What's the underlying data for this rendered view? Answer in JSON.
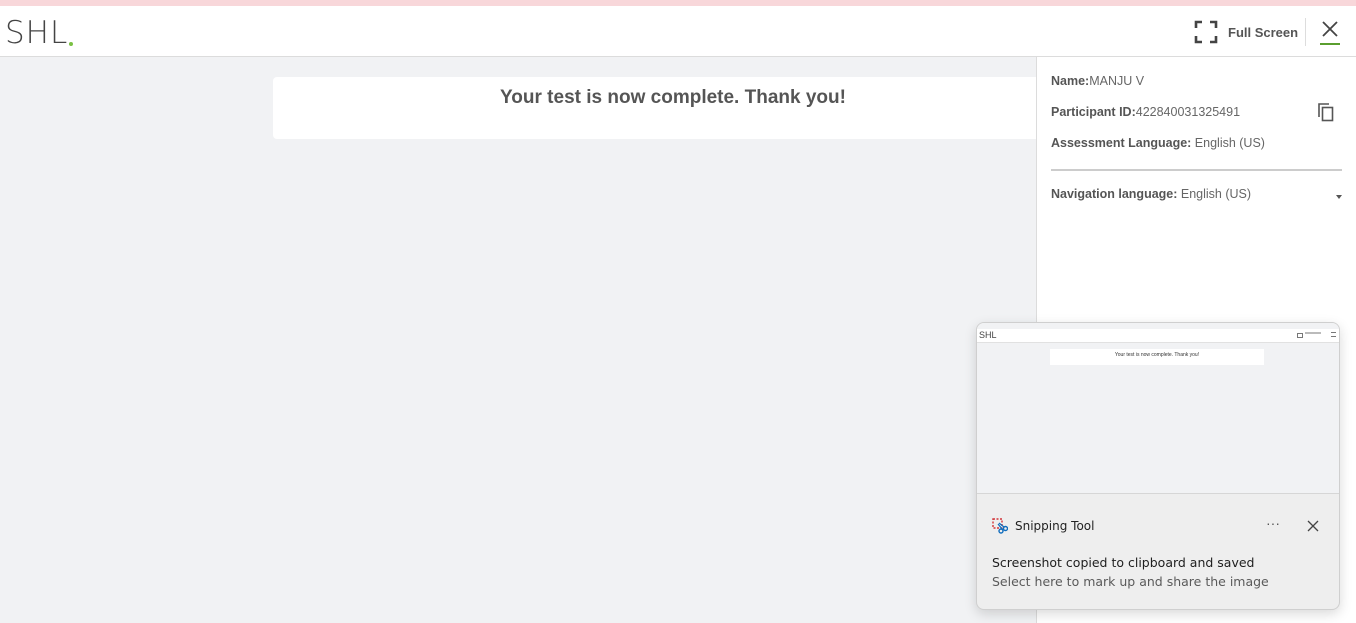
{
  "header": {
    "logo": "SHL",
    "fullscreen_label": "Full Screen"
  },
  "main": {
    "completion_message": "Your test is now complete. Thank you!"
  },
  "panel": {
    "name_label": "Name:",
    "name_value": "MANJU V",
    "participant_label": "Participant ID:",
    "participant_value": "422840031325491",
    "assessment_lang_label": "Assessment Language:",
    "assessment_lang_value": " English (US)",
    "nav_lang_label": "Navigation language:",
    "nav_lang_value": " English (US)"
  },
  "snip_notification": {
    "app_name": "Snipping Tool",
    "title": "Screenshot copied to clipboard and saved",
    "subtitle": "Select here to mark up and share the image",
    "more_label": "···",
    "thumbnail": {
      "logo": "SHL",
      "message": "Your test is now complete. Thank you!"
    }
  },
  "colors": {
    "accent_green": "#7ac143",
    "top_strip": "#f8d7da",
    "page_bg": "#f1f2f4"
  },
  "icons": {
    "fullscreen": "fullscreen-icon",
    "close": "close-icon",
    "copy": "copy-icon",
    "caret": "caret-down-icon",
    "snipping_tool": "snipping-tool-icon",
    "more": "more-icon"
  }
}
